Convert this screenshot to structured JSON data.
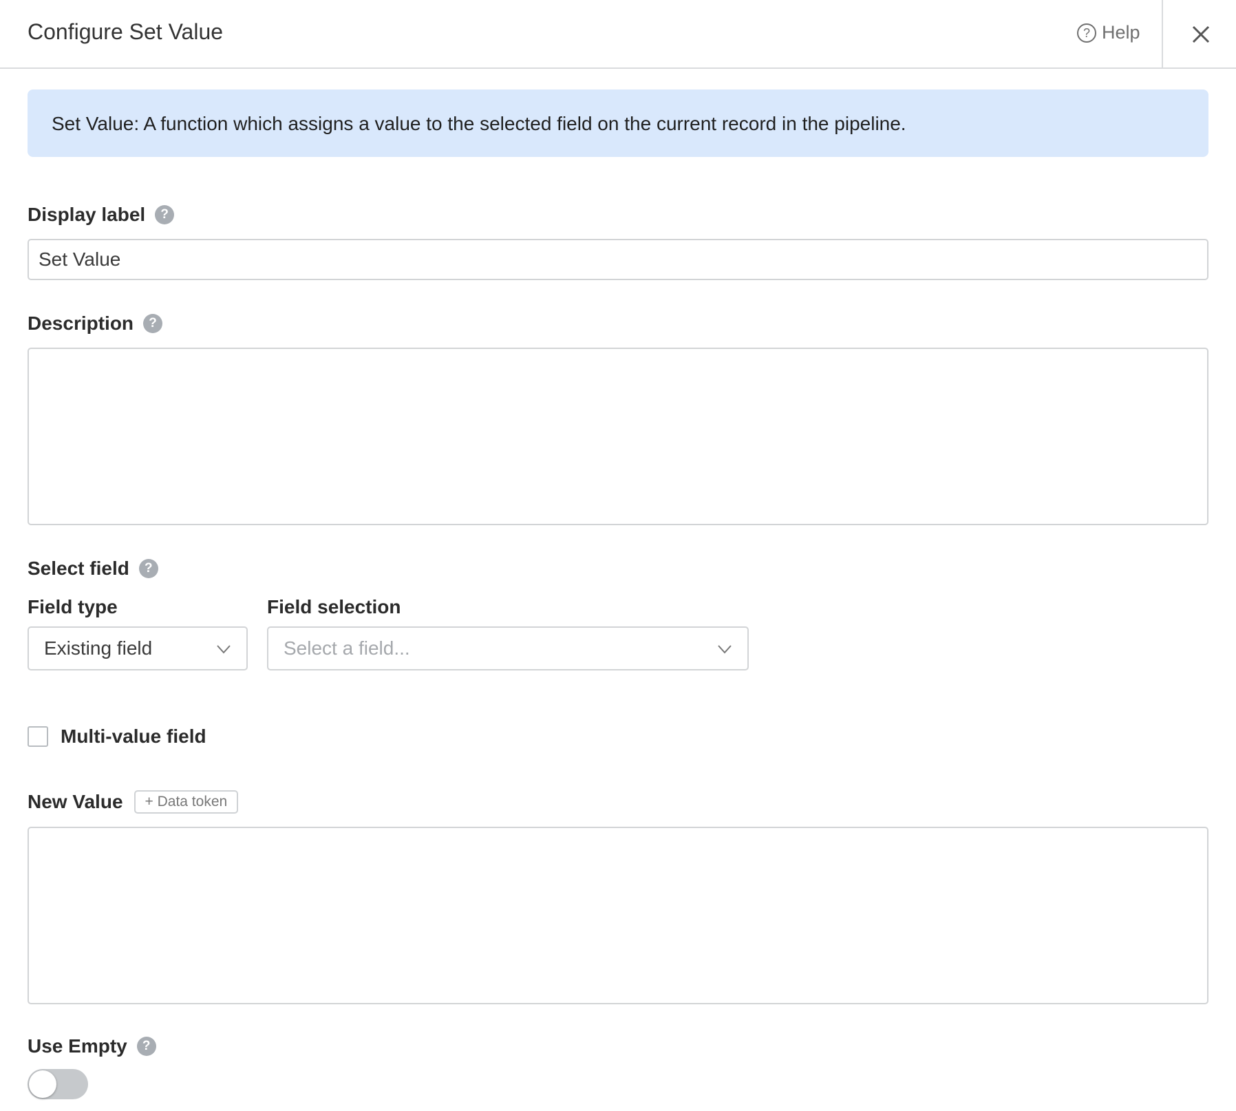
{
  "header": {
    "title": "Configure Set Value",
    "help_label": "Help",
    "help_icon_glyph": "?"
  },
  "info_banner": {
    "text": "Set Value: A function which assigns a value to the selected field on the current record in the pipeline."
  },
  "display_label": {
    "label": "Display label",
    "value": "Set Value"
  },
  "description": {
    "label": "Description",
    "value": ""
  },
  "select_field": {
    "label": "Select field",
    "field_type": {
      "label": "Field type",
      "value": "Existing field"
    },
    "field_selection": {
      "label": "Field selection",
      "placeholder": "Select a field..."
    }
  },
  "multi_value": {
    "label": "Multi-value field",
    "checked": false
  },
  "new_value": {
    "label": "New Value",
    "token_button": "+ Data token",
    "value": ""
  },
  "use_empty": {
    "label": "Use Empty",
    "enabled": false
  },
  "help_glyph": "?",
  "colors": {
    "banner_bg": "#d9e8fc",
    "border": "#d2d4d6",
    "help_badge": "#a8adb3",
    "toggle_off": "#c6c9cc"
  }
}
